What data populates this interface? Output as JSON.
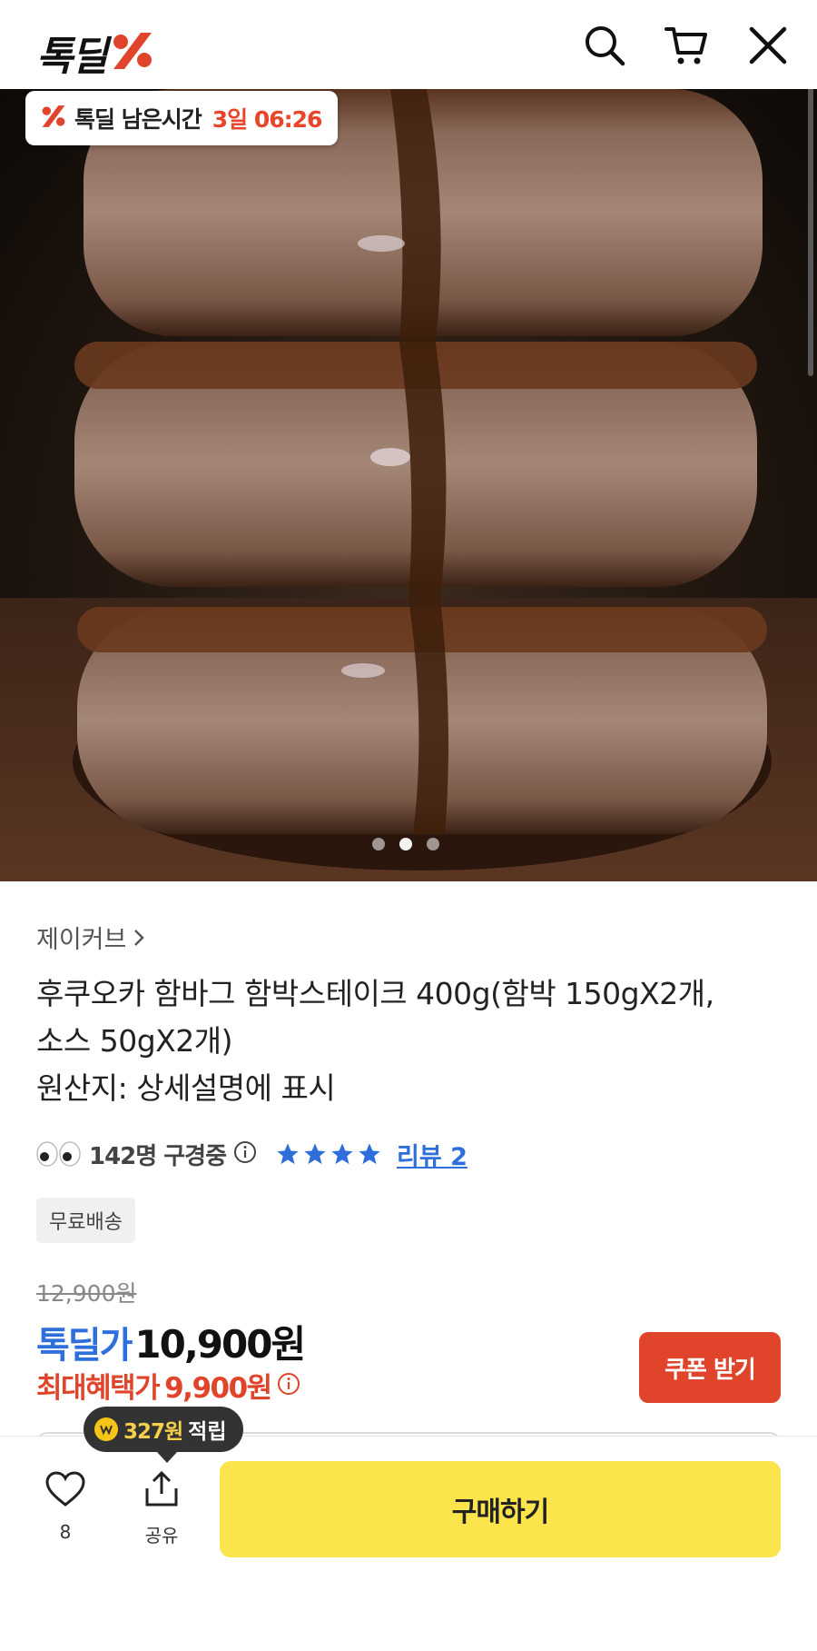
{
  "header": {
    "logo_text": "톡딜",
    "logo_color": "#e0442a"
  },
  "hero": {
    "timer_label": "톡딜 남은시간",
    "timer_value": "3일 06:26",
    "image_count": 3,
    "active_index": 1
  },
  "product": {
    "seller": "제이커브",
    "title_lines": [
      "후쿠오카 함바그 함박스테이크 400g(함박 150gX2개,",
      "소스 50gX2개)",
      "원산지: 상세설명에 표시"
    ],
    "viewers": "142명 구경중",
    "rating_stars": 4,
    "review_link": "리뷰 2",
    "shipping_badge": "무료배송"
  },
  "pricing": {
    "original_price": "12,900원",
    "deal_label": "톡딜가",
    "deal_price": "10,900원",
    "max_benefit_label": "최대혜택가",
    "max_benefit_price": "9,900원",
    "coupon_button": "쿠폰 받기",
    "accent_blue": "#2f6fdb",
    "accent_red": "#e0442a"
  },
  "bottom_bar": {
    "points_value": "327원",
    "points_text": "적립",
    "like_count": "8",
    "share_label": "공유",
    "buy_button": "구매하기",
    "buy_color": "#fbe44c"
  }
}
